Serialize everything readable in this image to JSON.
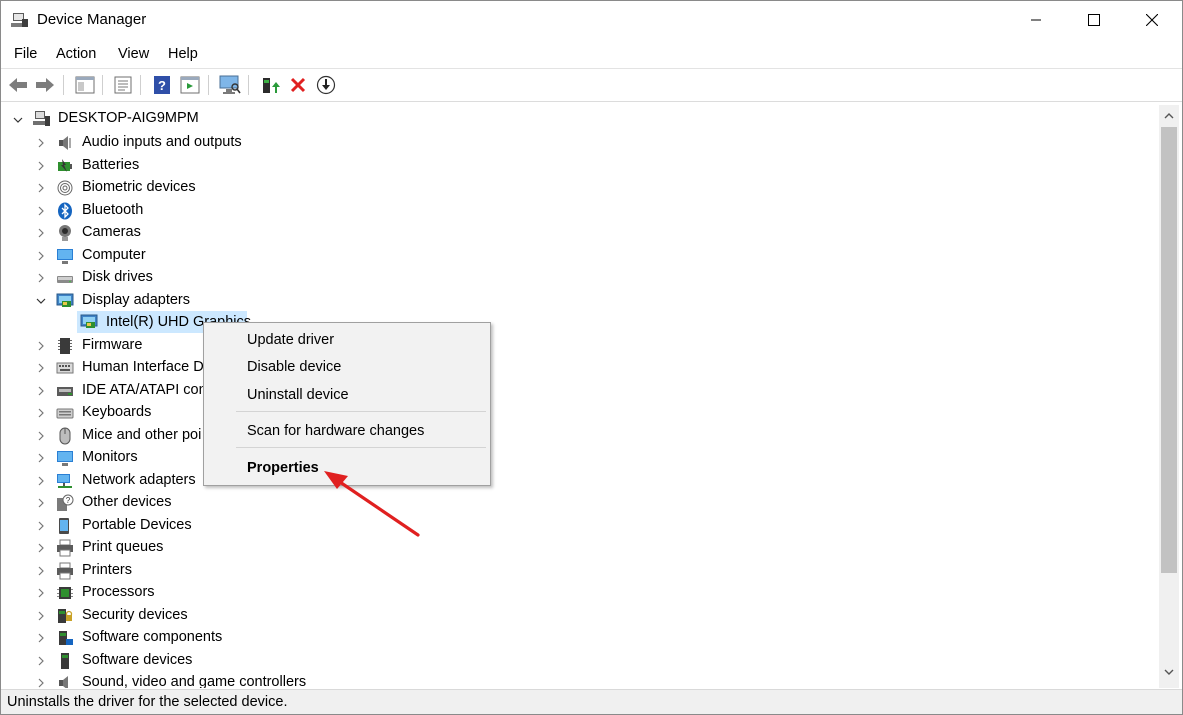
{
  "window": {
    "title": "Device Manager"
  },
  "menubar": [
    "File",
    "Action",
    "View",
    "Help"
  ],
  "toolbar": [
    "back-icon",
    "forward-icon",
    "show-hide-console-tree-icon",
    "properties-icon",
    "help-icon",
    "action-pane-icon",
    "scan-hardware-icon",
    "update-driver-icon",
    "uninstall-device-icon",
    "enable-device-icon"
  ],
  "tree": {
    "root": "DESKTOP-AIG9MPM",
    "categories": [
      {
        "label": "Audio inputs and outputs",
        "icon": "speaker-icon",
        "expanded": false
      },
      {
        "label": "Batteries",
        "icon": "battery-icon",
        "expanded": false
      },
      {
        "label": "Biometric devices",
        "icon": "fingerprint-icon",
        "expanded": false
      },
      {
        "label": "Bluetooth",
        "icon": "bluetooth-icon",
        "expanded": false
      },
      {
        "label": "Cameras",
        "icon": "camera-icon",
        "expanded": false
      },
      {
        "label": "Computer",
        "icon": "computer-icon",
        "expanded": false
      },
      {
        "label": "Disk drives",
        "icon": "disk-drive-icon",
        "expanded": false
      },
      {
        "label": "Display adapters",
        "icon": "display-adapter-icon",
        "expanded": true
      },
      {
        "label": "Firmware",
        "icon": "firmware-icon",
        "expanded": false
      },
      {
        "label": "Human Interface D",
        "icon": "hid-icon",
        "expanded": false
      },
      {
        "label": "IDE ATA/ATAPI contr",
        "icon": "ide-controller-icon",
        "expanded": false
      },
      {
        "label": "Keyboards",
        "icon": "keyboard-icon",
        "expanded": false
      },
      {
        "label": "Mice and other poi",
        "icon": "mouse-icon",
        "expanded": false
      },
      {
        "label": "Monitors",
        "icon": "monitor-icon",
        "expanded": false
      },
      {
        "label": "Network adapters",
        "icon": "network-adapter-icon",
        "expanded": false
      },
      {
        "label": "Other devices",
        "icon": "unknown-device-icon",
        "expanded": false
      },
      {
        "label": "Portable Devices",
        "icon": "portable-device-icon",
        "expanded": false
      },
      {
        "label": "Print queues",
        "icon": "print-queue-icon",
        "expanded": false
      },
      {
        "label": "Printers",
        "icon": "printer-icon",
        "expanded": false
      },
      {
        "label": "Processors",
        "icon": "processor-icon",
        "expanded": false
      },
      {
        "label": "Security devices",
        "icon": "security-device-icon",
        "expanded": false
      },
      {
        "label": "Software components",
        "icon": "software-component-icon",
        "expanded": false
      },
      {
        "label": "Software devices",
        "icon": "software-device-icon",
        "expanded": false
      },
      {
        "label": "Sound, video and game controllers",
        "icon": "sound-controller-icon",
        "expanded": false
      }
    ],
    "selected_child": "Intel(R) UHD Graphics"
  },
  "context_menu": {
    "items": [
      "Update driver",
      "Disable device",
      "Uninstall device",
      "Scan for hardware changes",
      "Properties"
    ],
    "bold_item": "Properties"
  },
  "annotation": {
    "arrow_color": "#e02020"
  },
  "status": "Uninstalls the driver for the selected device.",
  "colors": {
    "selection": "#cce8ff",
    "menu_bg": "#f2f2f2"
  }
}
